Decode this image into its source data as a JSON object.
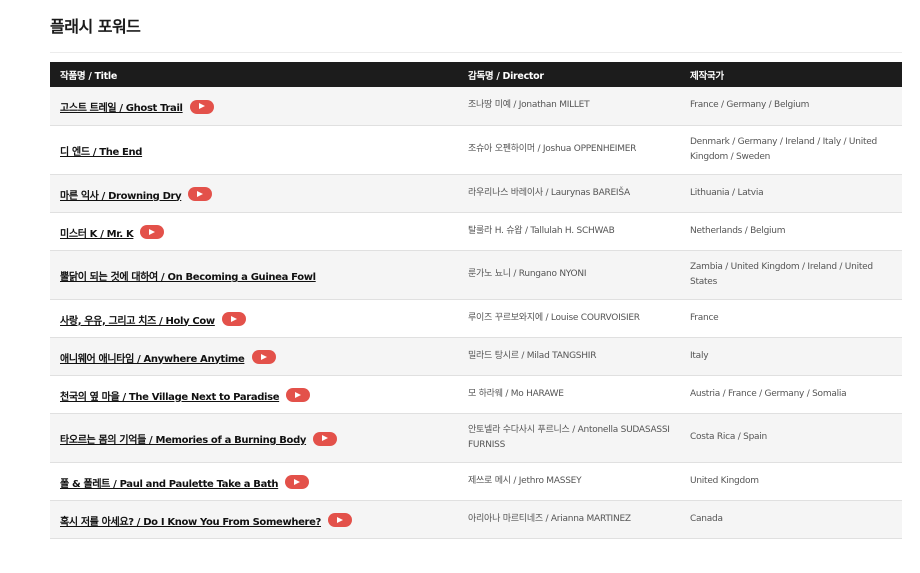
{
  "section_title": "플래시 포워드",
  "table": {
    "headers": {
      "title": "작품명 / Title",
      "director": "감독명 / Director",
      "country": "제작국가"
    },
    "rows": [
      {
        "title": "고스트 트레일 / Ghost Trail",
        "has_video": true,
        "director": "조나땅 미예 / Jonathan MILLET",
        "country": "France / Germany / Belgium"
      },
      {
        "title": "디 엔드 / The End",
        "has_video": false,
        "director": "조슈아 오펜하이머 / Joshua OPPENHEIMER",
        "country": "Denmark / Germany / Ireland / Italy / United Kingdom / Sweden"
      },
      {
        "title": "마른 익사 / Drowning Dry",
        "has_video": true,
        "director": "라우리나스 바레이사 / Laurynas BAREIŠA",
        "country": "Lithuania / Latvia"
      },
      {
        "title": "미스터 K / Mr. K",
        "has_video": true,
        "director": "탈룰라 H. 슈왑 / Tallulah H. SCHWAB",
        "country": "Netherlands / Belgium"
      },
      {
        "title": "뿔닭이 되는 것에 대하여 / On Becoming a Guinea Fowl",
        "has_video": false,
        "director": "룬가노 뇨니 / Rungano NYONI",
        "country": "Zambia / United Kingdom / Ireland / United States"
      },
      {
        "title": "사랑, 우유, 그리고 치즈 / Holy Cow",
        "has_video": true,
        "director": "루이즈 꾸르보와지에 / Louise COURVOISIER",
        "country": "France"
      },
      {
        "title": "애니웨어 애니타임 / Anywhere Anytime",
        "has_video": true,
        "director": "밀라드 탕시르 / Milad TANGSHIR",
        "country": "Italy"
      },
      {
        "title": "천국의 옆 마을 / The Village Next to Paradise",
        "has_video": true,
        "director": "모 하라웨 / Mo HARAWE",
        "country": "Austria / France / Germany / Somalia"
      },
      {
        "title": "타오르는 몸의 기억들 / Memories of a Burning Body",
        "has_video": true,
        "director": "안토넬라 수다사시 푸르니스 / Antonella SUDASASSI FURNISS",
        "country": "Costa Rica / Spain"
      },
      {
        "title": "폴 & 폴레트 / Paul and Paulette Take a Bath",
        "has_video": true,
        "director": "제쓰로 메시 / Jethro MASSEY",
        "country": "United Kingdom"
      },
      {
        "title": "혹시 저를 아세요? / Do I Know You From Somewhere?",
        "has_video": true,
        "director": "아리아나 마르티네즈 / Arianna MARTINEZ",
        "country": "Canada"
      }
    ]
  },
  "icons": {
    "play": "play-icon"
  },
  "colors": {
    "header_bg": "#1c1c1c",
    "play_badge": "#e3514a",
    "row_alt": "#f5f5f5"
  }
}
